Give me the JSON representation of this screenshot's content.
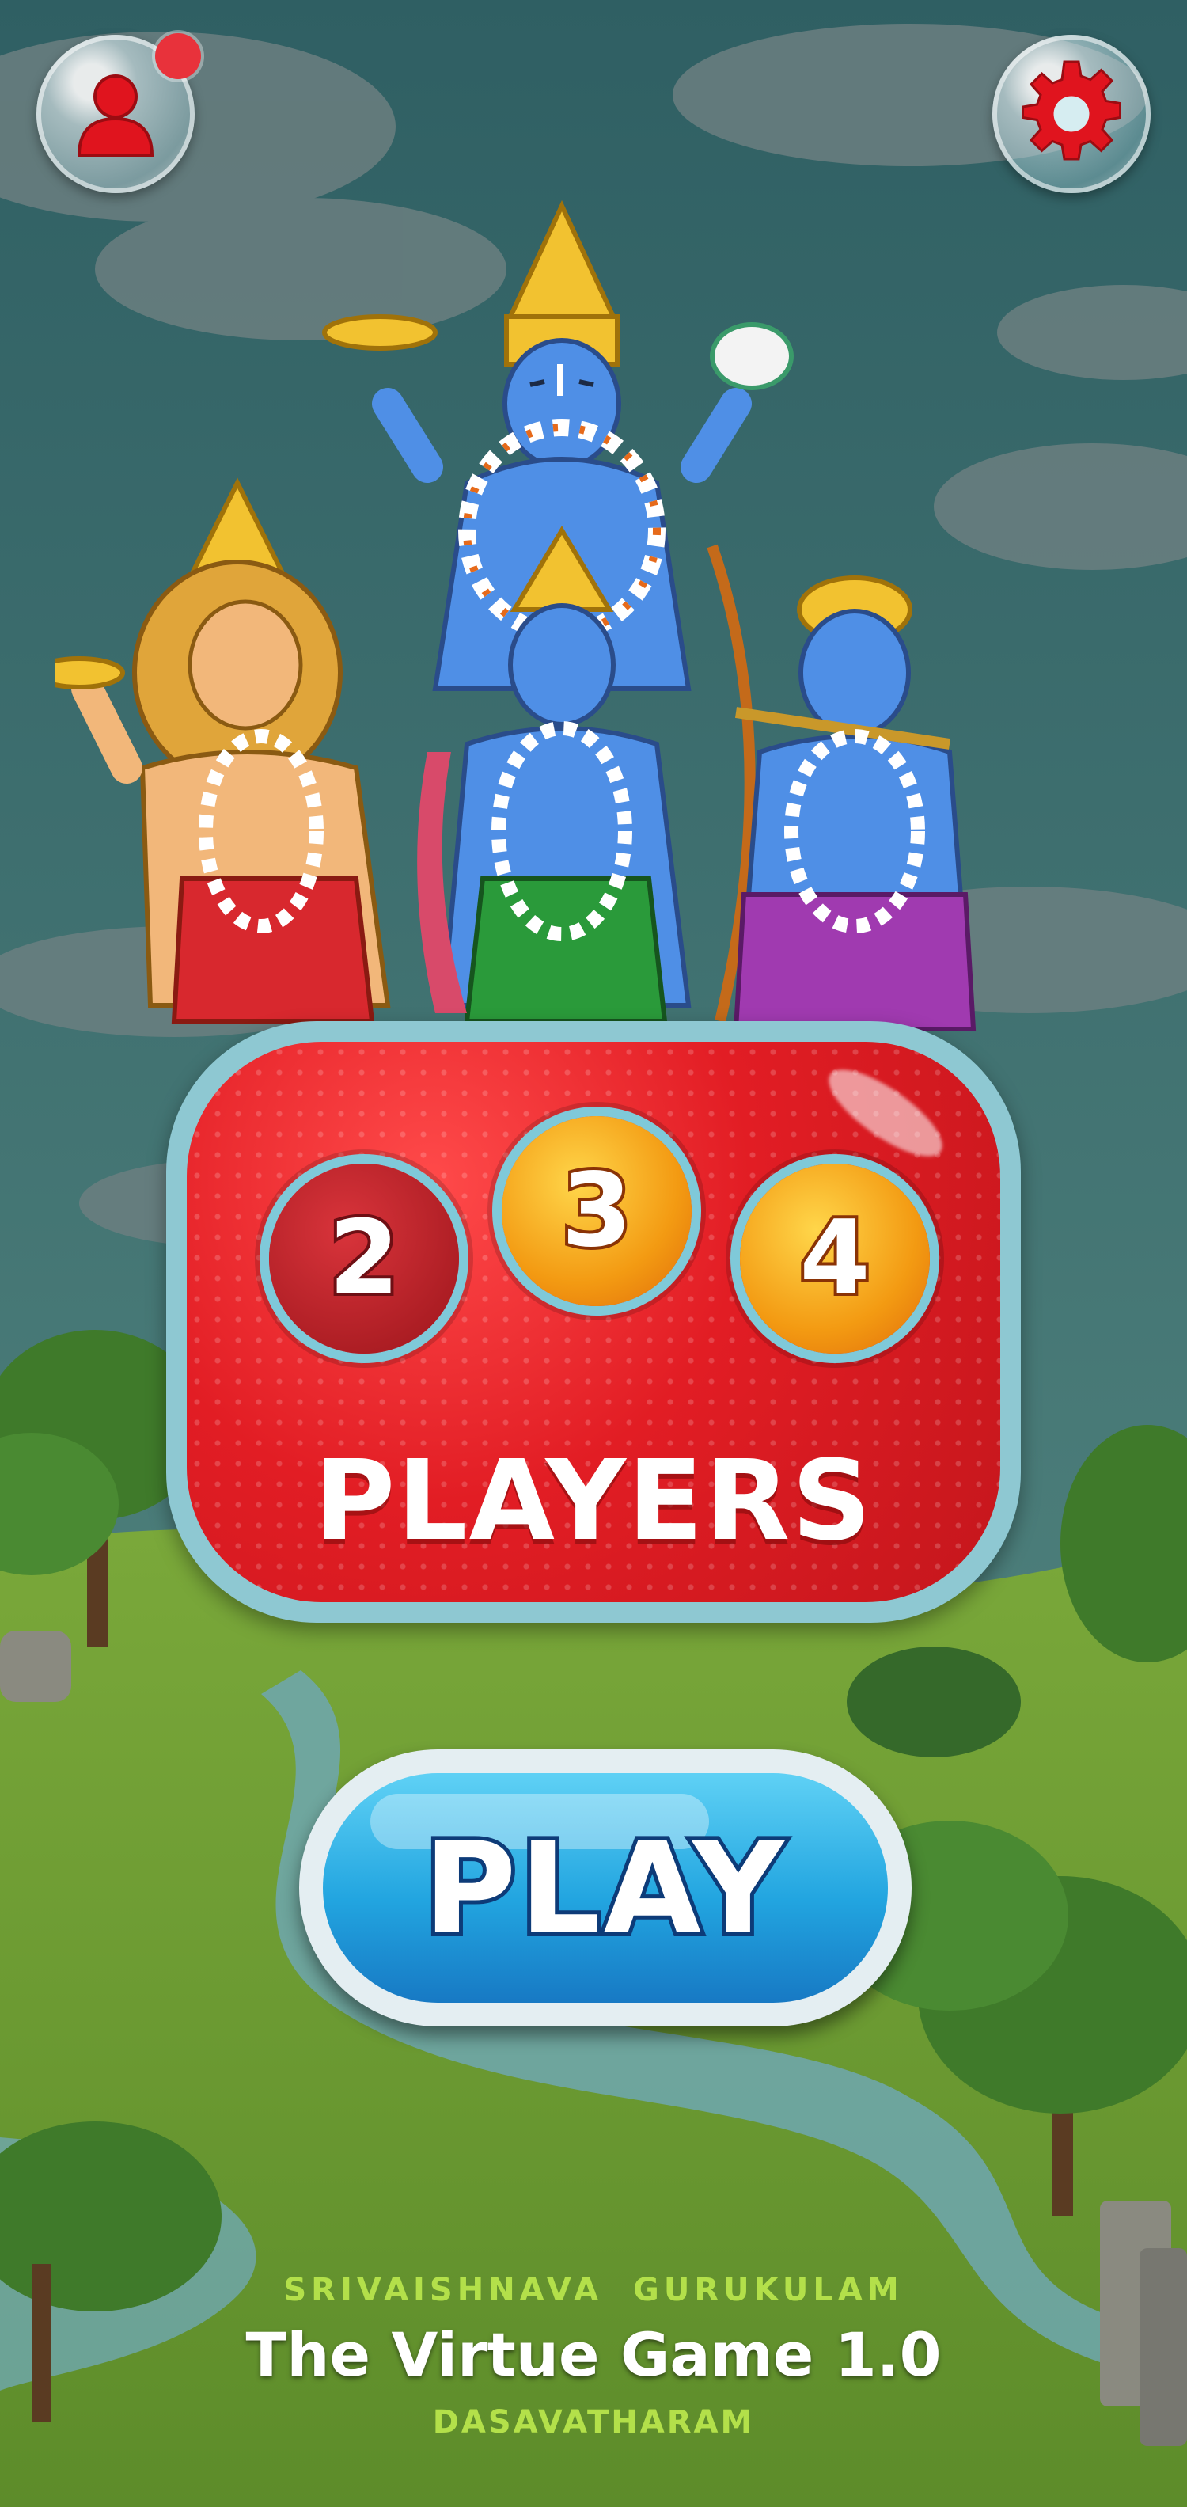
{
  "top_bar": {
    "profile_icon": "person-icon",
    "profile_notification": true,
    "settings_icon": "gear-icon"
  },
  "player_select": {
    "options": [
      "2",
      "3",
      "4"
    ],
    "selected": "3",
    "label": "PLAYERS"
  },
  "play_button": {
    "label": "PLAY"
  },
  "footer": {
    "organization": "SRIVAISHNAVA GURUKULAM",
    "title": "The Virtue Game 1.0",
    "subtitle": "DASAVATHARAM"
  },
  "colors": {
    "panel_red": "#e21d24",
    "panel_border": "#8ec8d2",
    "play_blue": "#22a5e0",
    "footer_green": "#b3e04a",
    "selected_gold": "#f39a12"
  }
}
